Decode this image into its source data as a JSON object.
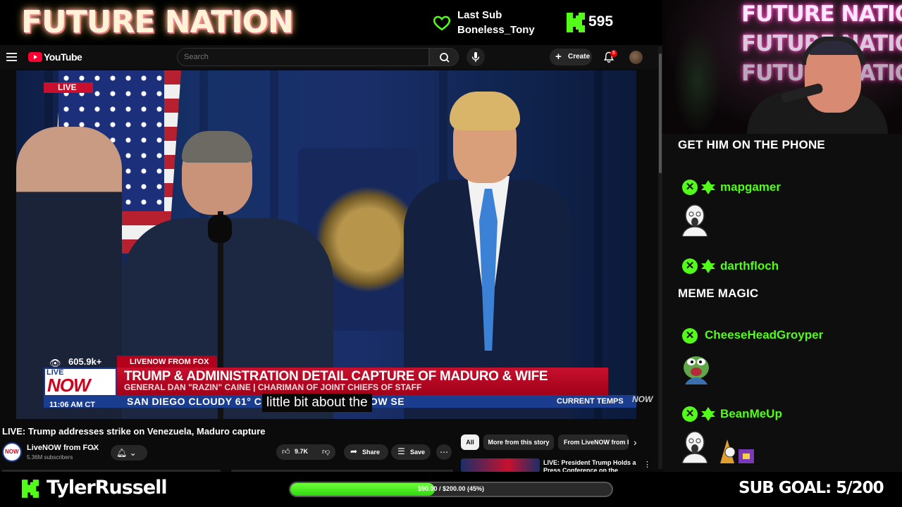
{
  "overlay": {
    "brand": "FUTURE NATION",
    "last_sub_title": "Last Sub",
    "last_sub_name": "Boneless_Tony",
    "follower_count": "595",
    "streamer_name": "TylerRussell",
    "goal_label": "$90.00 / $200.00 (45%)",
    "goal_progress": 0.45,
    "sub_goal": "SUB GOAL: 5/200",
    "accent_color": "#53fc18"
  },
  "youtube": {
    "brand": "YouTube",
    "search_placeholder": "Search",
    "create_label": "Create",
    "notification_count": "6"
  },
  "video": {
    "live_label": "LIVE",
    "view_count": "605.9k+",
    "source_tag": "LIVENOW FROM FOX",
    "logo_live": "LIVE",
    "logo_now": "NOW",
    "headline": "TRUMP & ADMINISTRATION DETAIL CAPTURE OF MADURO & WIFE",
    "subline": "GENERAL DAN \"RAZIN\" CAINE | CHARIMAN OF JOINT CHIEFS OF STAFF",
    "time": "11:06 AM CT",
    "ticker": "SAN DIEGO   CLOUDY 61°              CO   DRIZZLE 57°   LIVENOW   SE",
    "caption": "little bit about the",
    "ticker_label": "CURRENT TEMPS",
    "now_bug": "NOW"
  },
  "page": {
    "title": "LIVE: Trump addresses strike on Venezuela, Maduro capture",
    "channel_avatar_text": "NOW",
    "channel_name": "LiveNOW from FOX",
    "subscribers": "5.36M subscribers",
    "likes": "9.7K",
    "share_label": "Share",
    "save_label": "Save",
    "chips": [
      "All",
      "More from this story",
      "From LiveNOW from FOX"
    ],
    "rec_title": "LIVE: President Trump Holds a Press Conference on the"
  },
  "chat": {
    "messages": [
      {
        "user": "",
        "text": "GET HIM ON THE PHONE",
        "emote": ""
      },
      {
        "user": "mapgamer",
        "text": "",
        "emote": "soyjak-emote"
      },
      {
        "user": "darthfloch",
        "text": "MEME MAGIC",
        "emote": ""
      },
      {
        "user": "CheeseHeadGroyper",
        "text": "",
        "emote": "pepe-emote"
      },
      {
        "user": "BeanMeUp",
        "text": "",
        "emote": "soyjak-emote"
      }
    ]
  },
  "icons": {
    "heart": "heart-icon",
    "kick": "kick-logo-icon",
    "menu": "menu-icon",
    "search": "search-icon",
    "mic": "mic-icon",
    "bell": "bell-icon",
    "eye": "eye-icon"
  }
}
